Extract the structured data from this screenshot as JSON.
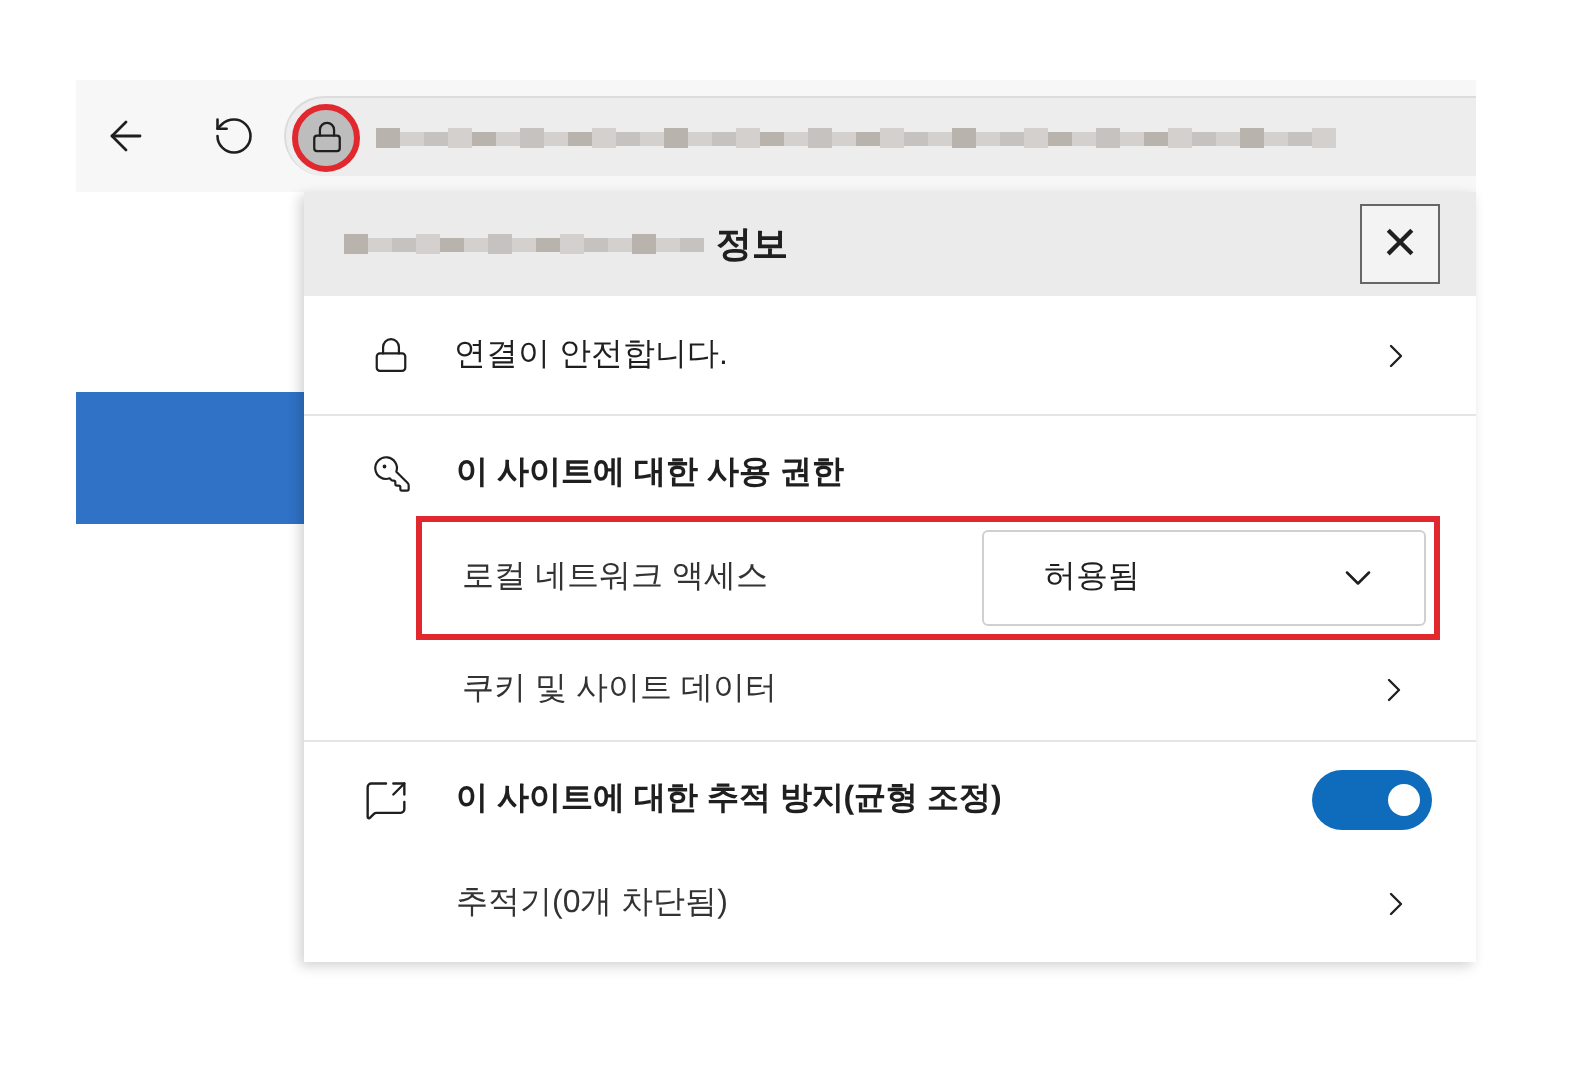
{
  "popup": {
    "title": "정보",
    "close": "×"
  },
  "connection": {
    "label": "연결이 안전합니다."
  },
  "permissions": {
    "title": "이 사이트에 대한 사용 권한",
    "items": [
      {
        "kind": "dropdown",
        "label": "로컬 네트워크 액세스",
        "value": "허용됨",
        "highlighted": true
      },
      {
        "kind": "link",
        "label": "쿠키 및 사이트 데이터",
        "highlighted": false
      }
    ]
  },
  "tracking": {
    "title": "이 사이트에 대한 추적 방지(균형 조정)",
    "on": true,
    "trackers": "추적기(0개 차단됨)"
  }
}
